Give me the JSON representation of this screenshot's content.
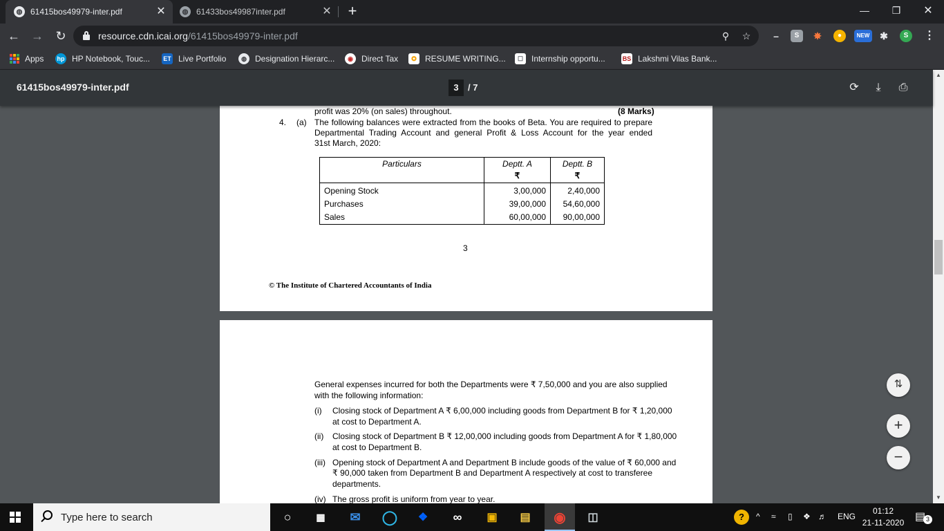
{
  "browser": {
    "tabs": [
      {
        "title": "61415bos49979-inter.pdf",
        "close": "✕"
      },
      {
        "title": "61433bos49987inter.pdf",
        "close": "✕"
      }
    ],
    "newtab": "+",
    "url_host": "resource.cdn.icai.org",
    "url_path": "/61415bos49979-inter.pdf",
    "ext_new_badge": "NEW",
    "profile_initial": "S"
  },
  "bookmarks": [
    {
      "label": "Apps"
    },
    {
      "label": "HP Notebook, Touc..."
    },
    {
      "label": "Live Portfolio"
    },
    {
      "label": "Designation Hierarc..."
    },
    {
      "label": "Direct Tax"
    },
    {
      "label": "RESUME WRITING..."
    },
    {
      "label": "Internship opportu..."
    },
    {
      "label": "Lakshmi Vilas Bank..."
    }
  ],
  "pdf": {
    "filename": "61415bos49979-inter.pdf",
    "current_page": "3",
    "total_pages": "/ 7"
  },
  "doc": {
    "line_top": "profit was 20% (on sales) throughout.",
    "marks": "(8 Marks)",
    "q_num": "4.",
    "q_part": "(a)",
    "q_line1": "The following balances were extracted from the books of Beta. You are required to prepare",
    "q_line2": "Departmental Trading Account and general Profit & Loss Account for the year ended",
    "q_line3": "31st March, 2020:",
    "table": {
      "headers": [
        "Particulars",
        "Deptt. A",
        "Deptt. B"
      ],
      "currency": "₹",
      "rows": [
        [
          "Opening Stock",
          "3,00,000",
          "2,40,000"
        ],
        [
          "Purchases",
          "39,00,000",
          "54,60,000"
        ],
        [
          "Sales",
          "60,00,000",
          "90,00,000"
        ]
      ]
    },
    "page_number": "3",
    "footer": "© The Institute of Chartered Accountants of India",
    "p2_line1": "General expenses incurred for both the Departments were ₹ 7,50,000 and you are also supplied",
    "p2_line2": "with the following information:",
    "items": [
      {
        "num": "(i)",
        "l1": "Closing stock of Department A ₹ 6,00,000 including goods from Department B for ₹ 1,20,000",
        "l2": "at cost to Department A."
      },
      {
        "num": "(ii)",
        "l1": "Closing stock of Department B ₹ 12,00,000 including goods from Department A for ₹ 1,80,000",
        "l2": "at cost to Department B."
      },
      {
        "num": "(iii)",
        "l1": "Opening stock of Department A and Department B include goods of the value of ₹ 60,000 and",
        "l2": "₹ 90,000 taken from Department B and Department A respectively at cost to transferee",
        "l3": "departments."
      },
      {
        "num": "(iv)",
        "l1": "The gross profit is uniform from year to year."
      }
    ]
  },
  "taskbar": {
    "search_placeholder": "Type here to search",
    "lang": "ENG",
    "time": "01:12",
    "date": "21-11-2020",
    "notif_count": "3"
  }
}
